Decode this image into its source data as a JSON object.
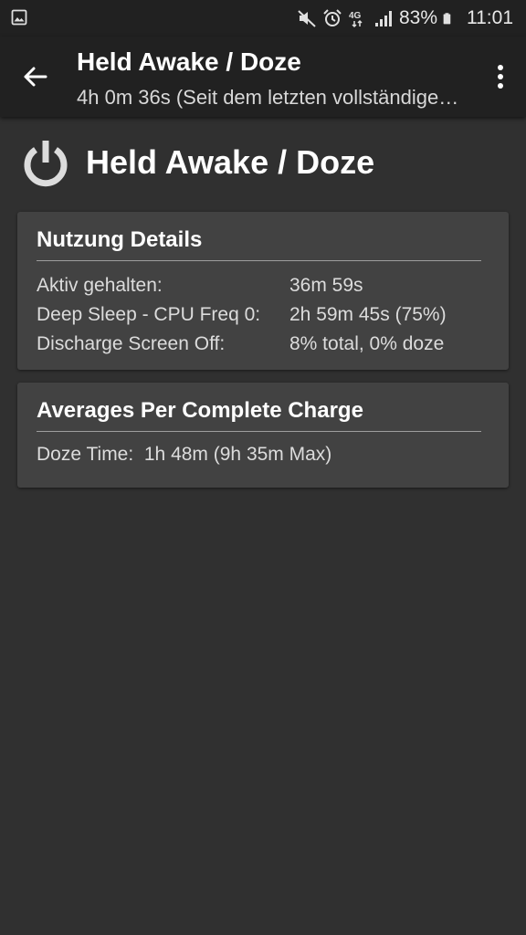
{
  "status_bar": {
    "battery_percent": "83%",
    "time": "11:01",
    "network_label": "4G",
    "icons": [
      "image-icon",
      "mute-icon",
      "alarm-icon",
      "network-4g-icon",
      "signal-icon",
      "battery-icon"
    ]
  },
  "app_bar": {
    "title": "Held Awake / Doze",
    "subtitle": "4h 0m 36s (Seit dem letzten vollständigen Aufladen)",
    "back_icon": "arrow-back-icon",
    "menu_icon": "more-vert-icon",
    "background": "#212121"
  },
  "header": {
    "icon": "power-icon",
    "title": "Held Awake / Doze"
  },
  "usage_card": {
    "title": "Nutzung Details",
    "rows": [
      {
        "label": "Aktiv gehalten:",
        "value": "36m 59s"
      },
      {
        "label": "Deep Sleep - CPU Freq 0:",
        "value": "2h 59m 45s (75%)"
      },
      {
        "label": "Discharge Screen Off:",
        "value": "8% total, 0% doze"
      }
    ]
  },
  "averages_card": {
    "title": "Averages Per Complete Charge",
    "rows": [
      {
        "label": "Doze Time:",
        "value": "1h 48m (9h 35m Max)"
      }
    ]
  },
  "colors": {
    "background": "#303030",
    "card": "#424242",
    "toolbar": "#212121",
    "text_primary": "#ffffff",
    "text_secondary": "#dcdcdc"
  }
}
